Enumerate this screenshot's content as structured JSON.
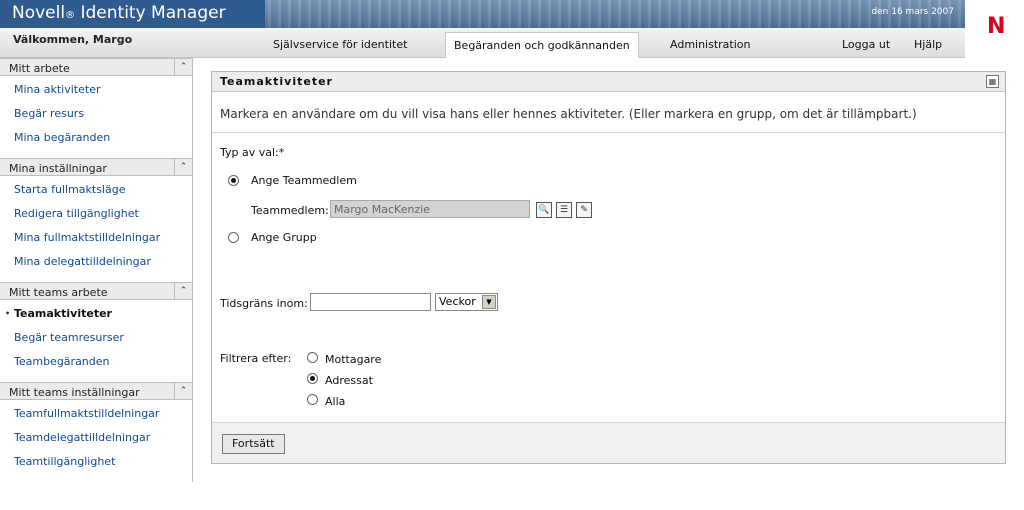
{
  "header": {
    "brand_name": "Novell",
    "brand_reg": "®",
    "product": "Identity Manager",
    "date": "den 16 mars 2007",
    "logo_letter": "N",
    "welcome": "Välkommen, Margo"
  },
  "nav": {
    "tabs": [
      {
        "label": "Självservice för identitet",
        "active": false
      },
      {
        "label": "Begäranden och godkännanden",
        "active": true
      },
      {
        "label": "Administration",
        "active": false
      }
    ],
    "logout": "Logga ut",
    "help": "Hjälp"
  },
  "sidebar": {
    "sections": [
      {
        "title": "Mitt arbete",
        "items": [
          "Mina aktiviteter",
          "Begär resurs",
          "Mina begäranden"
        ]
      },
      {
        "title": "Mina inställningar",
        "items": [
          "Starta fullmaktsläge",
          "Redigera tillgänglighet",
          "Mina fullmaktstilldelningar",
          "Mina delegattilldelningar"
        ]
      },
      {
        "title": "Mitt teams arbete",
        "items": [
          "Teamaktiviteter",
          "Begär teamresurser",
          "Teambegäranden"
        ]
      },
      {
        "title": "Mitt teams inställningar",
        "items": [
          "Teamfullmaktstilldelningar",
          "Teamdelegattilldelningar",
          "Teamtillgänglighet"
        ]
      }
    ],
    "current_item": "Teamaktiviteter"
  },
  "panel": {
    "title": "Teamaktiviteter",
    "intro": "Markera en användare om du vill visa hans eller hennes aktiviteter. (Eller markera en grupp, om det är tillämpbart.)",
    "choice_label": "Typ av val:*",
    "option_member": "Ange Teammedlem",
    "member_label": "Teammedlem:",
    "member_value": "Margo MacKenzie",
    "option_group": "Ange Grupp",
    "time_label": "Tidsgräns inom:",
    "time_value": "",
    "time_unit": "Veckor",
    "filter_label": "Filtrera efter:",
    "filter_options": [
      "Mottagare",
      "Adressat",
      "Alla"
    ],
    "filter_selected": "Adressat",
    "continue": "Fortsätt"
  },
  "colors": {
    "brand_blue": "#2f5b8f",
    "link_blue": "#12498c",
    "logo_red": "#d8001d"
  }
}
